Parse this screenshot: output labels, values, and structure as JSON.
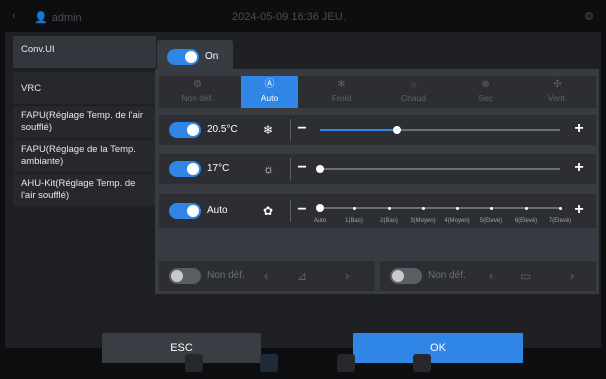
{
  "topbar": {
    "back_icon": "‹",
    "user_icon": "👤",
    "user": "admin",
    "datetime": "2024-05-09 16:36 JEU.",
    "gear_icon": "⚙"
  },
  "sidebar": {
    "items": [
      {
        "label": "Conv.UI",
        "active": true
      },
      {
        "label": "VRC",
        "active": false
      },
      {
        "label": "FAPU(Réglage Temp. de l'air soufflé)",
        "active": false
      },
      {
        "label": "FAPU(Réglage de la Temp. ambiante)",
        "active": false
      },
      {
        "label": "AHU-Kit(Réglage Temp. de l'air soufflé)",
        "active": false
      }
    ]
  },
  "power": {
    "label": "On",
    "on": true
  },
  "modes": [
    {
      "label": "Non déf.",
      "icon": "⚙",
      "icon_name": "undefined-mode-icon",
      "selected": false
    },
    {
      "label": "Auto",
      "icon": "Ⓐ",
      "icon_name": "auto-mode-icon",
      "selected": true
    },
    {
      "label": "Froid",
      "icon": "❄",
      "icon_name": "snowflake-icon",
      "selected": false
    },
    {
      "label": "Chaud",
      "icon": "☼",
      "icon_name": "sun-icon",
      "selected": false
    },
    {
      "label": "Sec",
      "icon": "⊗",
      "icon_name": "drop-icon",
      "selected": false
    },
    {
      "label": "Vent.",
      "icon": "✣",
      "icon_name": "fan-icon",
      "selected": false
    }
  ],
  "cool_row": {
    "value": "20.5°C",
    "on": true,
    "icon": "❄",
    "level": 0.32,
    "minus": "−",
    "plus": "+"
  },
  "heat_row": {
    "value": "17°C",
    "on": true,
    "icon": "☼",
    "level": 0.0,
    "minus": "−",
    "plus": "+"
  },
  "fan_row": {
    "value": "Auto",
    "on": true,
    "icon": "✿",
    "minus": "−",
    "plus": "+",
    "selected_index": 0,
    "ticks": [
      "Auto",
      "1(Bas)",
      "2(Bas)",
      "3(Moyen)",
      "4(Moyen)",
      "5(Elevé)",
      "6(Elevé)",
      "7(Elevé)"
    ]
  },
  "louver_left": {
    "label": "Non déf.",
    "on": false,
    "icon": "⊿",
    "prev": "‹",
    "next": "›"
  },
  "louver_right": {
    "label": "Non déf.",
    "on": false,
    "icon": "▭",
    "prev": "‹",
    "next": "›"
  },
  "buttons": {
    "esc": "ESC",
    "ok": "OK"
  },
  "colors": {
    "accent": "#2f86e6",
    "panel": "#383b42",
    "row": "#2c2e33"
  }
}
